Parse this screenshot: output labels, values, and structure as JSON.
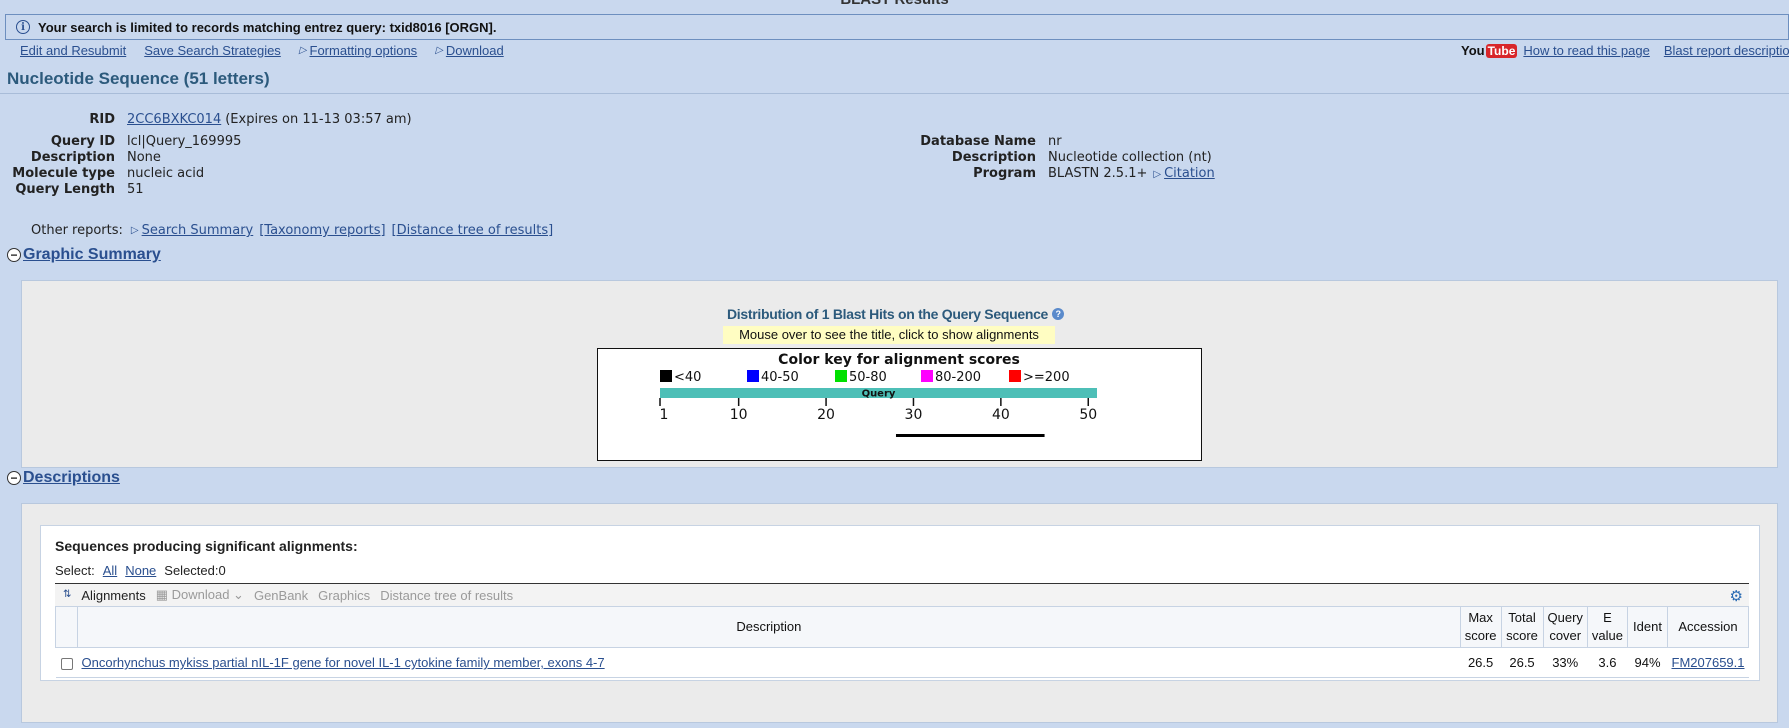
{
  "page": {
    "title": "BLAST Results"
  },
  "notice": {
    "text": "Your search is limited to records matching entrez query: txid8016 [ORGN]."
  },
  "toolbar": {
    "edit_resubmit": "Edit and Resubmit",
    "save_strategies": "Save Search Strategies",
    "formatting": "Formatting options",
    "download": "Download",
    "youtube_you": "You",
    "youtube_tube": "Tube",
    "how_to_read": "How to read this page",
    "blast_report": "Blast report description"
  },
  "sequence_title": "Nucleotide Sequence (51 letters)",
  "rid": {
    "label": "RID",
    "value": "2CC6BXKC014",
    "expires": "(Expires on 11-13 03:57 am)"
  },
  "query_info": [
    {
      "label": "Query ID",
      "value": "lcl|Query_169995"
    },
    {
      "label": "Description",
      "value": "None"
    },
    {
      "label": "Molecule type",
      "value": "nucleic acid"
    },
    {
      "label": "Query Length",
      "value": "51"
    }
  ],
  "db_info": [
    {
      "label": "Database Name",
      "value": "nr"
    },
    {
      "label": "Description",
      "value": "Nucleotide collection (nt)"
    },
    {
      "label": "Program",
      "value": "BLASTN 2.5.1+"
    }
  ],
  "citation": "Citation",
  "other_reports": {
    "label": "Other reports:",
    "search_summary": "Search Summary",
    "taxonomy": "[Taxonomy reports]",
    "distance_tree": "[Distance tree of results]"
  },
  "graphic_summary": {
    "heading": "Graphic Summary",
    "dist_title": "Distribution of 1 Blast Hits on the Query Sequence",
    "mouse_note": "Mouse over to see the title, click to show alignments",
    "color_key_title": "Color key for alignment scores",
    "color_key": [
      {
        "label": "<40",
        "color": "#000000"
      },
      {
        "label": "40-50",
        "color": "#0000ff"
      },
      {
        "label": "50-80",
        "color": "#00e000"
      },
      {
        "label": "80-200",
        "color": "#ff00ff"
      },
      {
        "label": ">=200",
        "color": "#ff0000"
      }
    ],
    "query_label": "Query",
    "query_bar_color": "#4dbfb7",
    "query_length": 51,
    "ticks": [
      "1",
      "10",
      "20",
      "30",
      "40",
      "50"
    ],
    "hits": [
      {
        "start": 28,
        "end": 45,
        "color": "#000000"
      }
    ]
  },
  "descriptions": {
    "heading": "Descriptions",
    "seq_producing": "Sequences producing significant alignments:",
    "select_label": "Select:",
    "select_all": "All",
    "select_none": "None",
    "selected": "Selected:0",
    "tools": {
      "alignments": "Alignments",
      "download": "Download",
      "genbank": "GenBank",
      "graphics": "Graphics",
      "distance_tree": "Distance tree of results"
    },
    "columns": {
      "description": "Description",
      "max_score_1": "Max",
      "max_score_2": "score",
      "total_score_1": "Total",
      "total_score_2": "score",
      "query_cover_1": "Query",
      "query_cover_2": "cover",
      "e_value_1": "E",
      "e_value_2": "value",
      "ident": "Ident",
      "accession": "Accession"
    },
    "rows": [
      {
        "description": "Oncorhynchus mykiss partial nIL-1F gene for novel IL-1 cytokine family member, exons 4-7",
        "max_score": "26.5",
        "total_score": "26.5",
        "query_cover": "33%",
        "e_value": "3.6",
        "ident": "94%",
        "accession": "FM207659.1"
      }
    ]
  }
}
